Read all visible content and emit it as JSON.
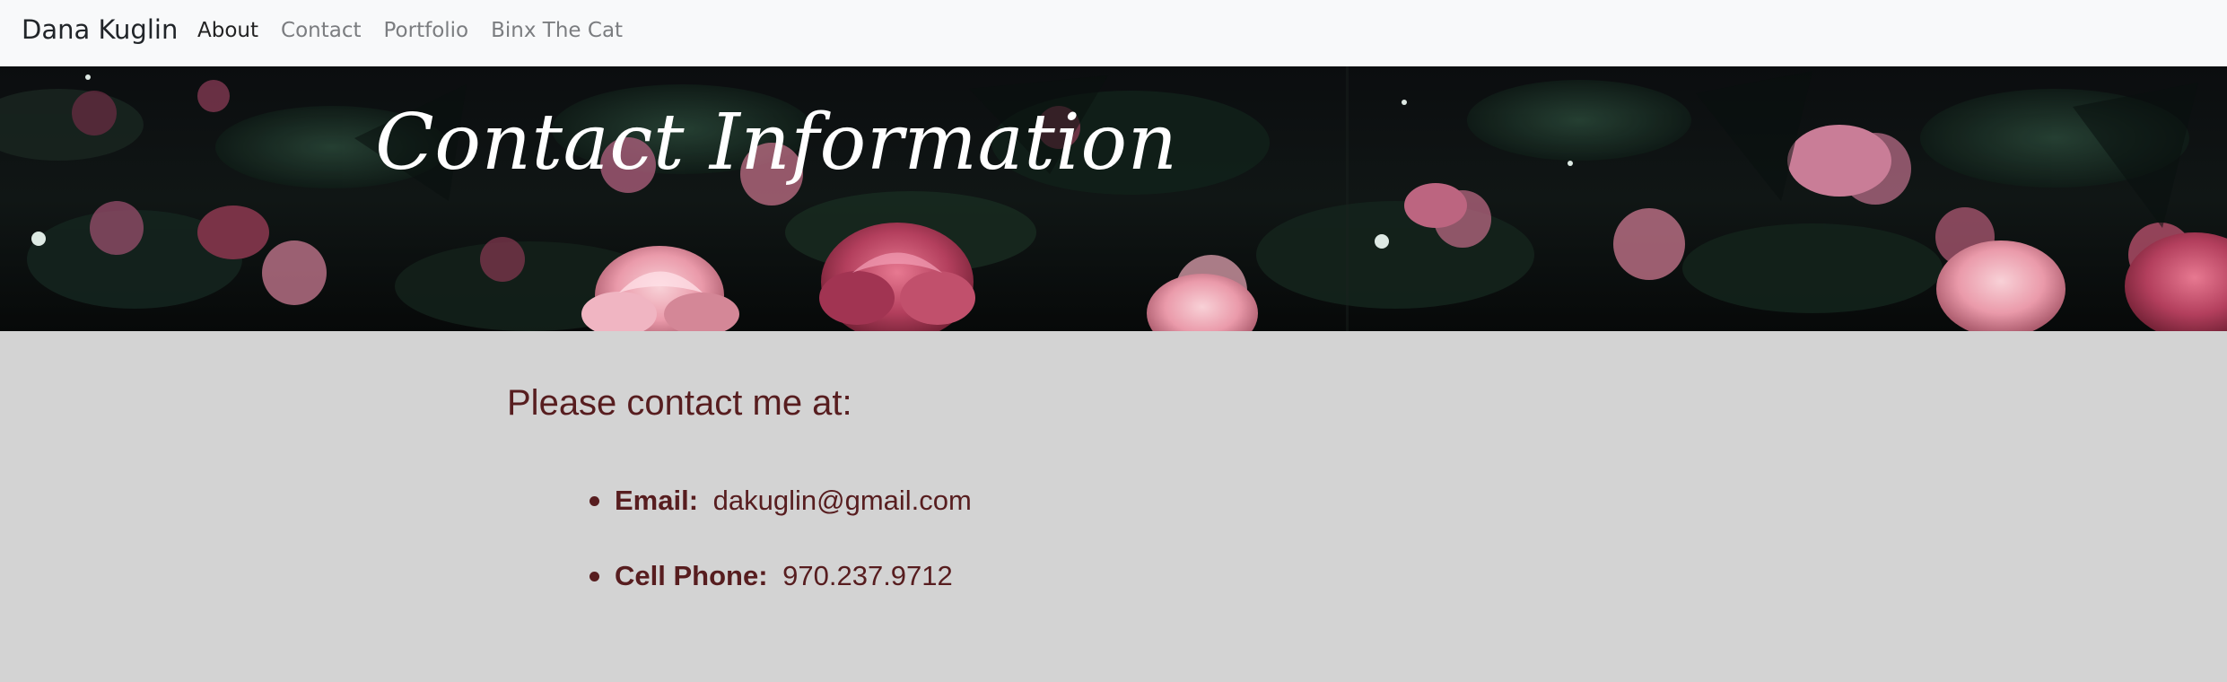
{
  "navbar": {
    "brand": "Dana Kuglin",
    "links": [
      {
        "label": "About",
        "active": true
      },
      {
        "label": "Contact",
        "active": false
      },
      {
        "label": "Portfolio",
        "active": false
      },
      {
        "label": "Binx The Cat",
        "active": false
      }
    ]
  },
  "hero": {
    "title": "Contact Information",
    "image_icon": "pink-flower-banner"
  },
  "contact": {
    "heading": "Please contact me at:",
    "items": [
      {
        "label": "Email:",
        "value": "dakuglin@gmail.com"
      },
      {
        "label": "Cell Phone:",
        "value": "970.237.9712"
      }
    ]
  },
  "colors": {
    "nav_bg": "#f8f9fa",
    "brand_text": "#212529",
    "nav_muted": "#7b7d80",
    "hero_bg": "#0e1112",
    "content_bg": "#d3d3d3",
    "accent_text": "#571d1f"
  }
}
